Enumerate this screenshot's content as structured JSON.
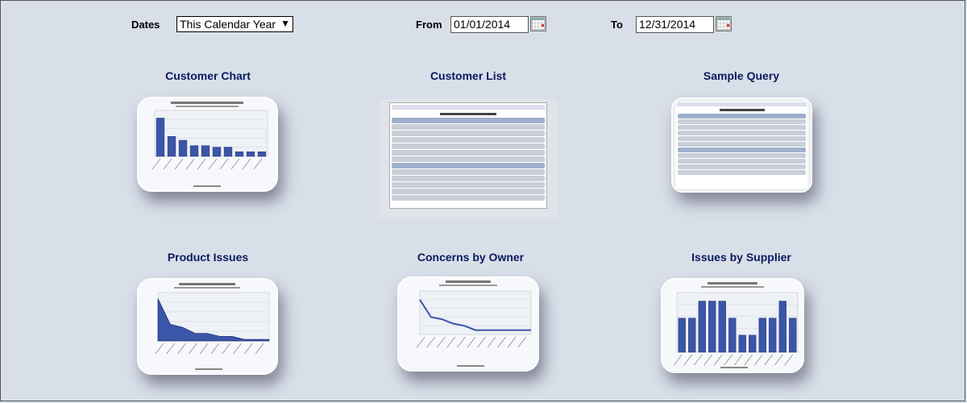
{
  "filters": {
    "dates_label": "Dates",
    "dates_value": "This Calendar Year",
    "from_label": "From",
    "from_value": "01/01/2014",
    "to_label": "To",
    "to_value": "12/31/2014"
  },
  "cards": [
    {
      "title": "Customer Chart"
    },
    {
      "title": "Customer List"
    },
    {
      "title": "Sample Query"
    },
    {
      "title": "Product Issues"
    },
    {
      "title": "Concerns by Owner"
    },
    {
      "title": "Issues by Supplier"
    }
  ],
  "colors": {
    "accent": "#3b55a8",
    "title": "#0a1a5c",
    "background": "#d8dfe9"
  },
  "icons": {
    "calendar": "calendar-icon",
    "dropdown": "chevron-down-icon"
  },
  "chart_data": [
    {
      "type": "bar",
      "values": [
        10,
        5.2,
        4.2,
        2.8,
        2.8,
        2.4,
        2.4,
        1.2,
        1.2,
        1.2
      ],
      "ylim": [
        0,
        12
      ]
    },
    {
      "type": "area",
      "values": [
        14,
        5.5,
        4.5,
        2.5,
        2.5,
        1.5,
        1.5,
        0.5,
        0.5,
        0.5
      ],
      "ylim": [
        0,
        16
      ]
    },
    {
      "type": "line",
      "values": [
        8,
        4,
        3.5,
        2.5,
        2,
        1,
        1,
        1,
        1,
        1,
        1
      ],
      "ylim": [
        0,
        10
      ]
    },
    {
      "type": "bar",
      "values": [
        200,
        200,
        300,
        300,
        300,
        200,
        100,
        100,
        200,
        200,
        300,
        200
      ],
      "ylim": [
        0,
        350
      ]
    }
  ]
}
